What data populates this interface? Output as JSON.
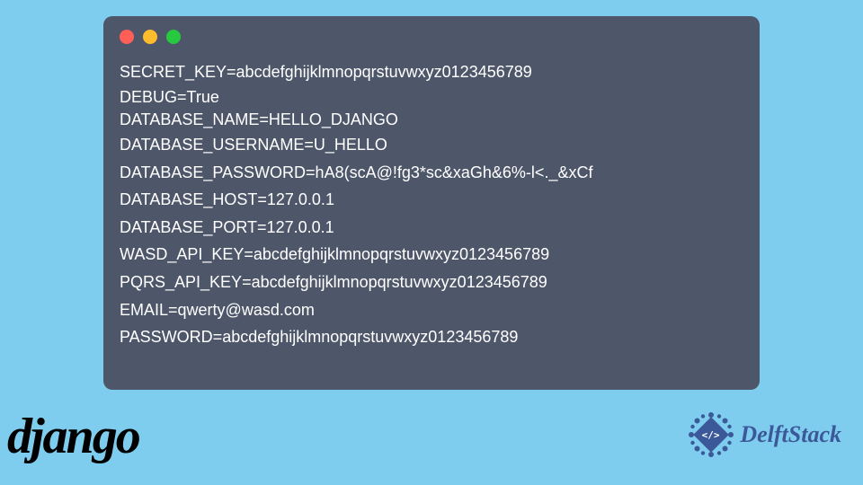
{
  "env_lines": [
    "SECRET_KEY=abcdefghijklmnopqrstuvwxyz0123456789",
    "DEBUG=True",
    "DATABASE_NAME=HELLO_DJANGO",
    "DATABASE_USERNAME=U_HELLO",
    "DATABASE_PASSWORD=hA8(scA@!fg3*sc&xaGh&6%-l<._&xCf",
    "DATABASE_HOST=127.0.0.1",
    "DATABASE_PORT=127.0.0.1",
    "WASD_API_KEY=abcdefghijklmnopqrstuvwxyz0123456789",
    "PQRS_API_KEY=abcdefghijklmnopqrstuvwxyz0123456789",
    "EMAIL=qwerty@wasd.com",
    "PASSWORD=abcdefghijklmnopqrstuvwxyz0123456789"
  ],
  "logos": {
    "django": "django",
    "delftstack": "DelftStack",
    "delftstack_code": "</>"
  }
}
